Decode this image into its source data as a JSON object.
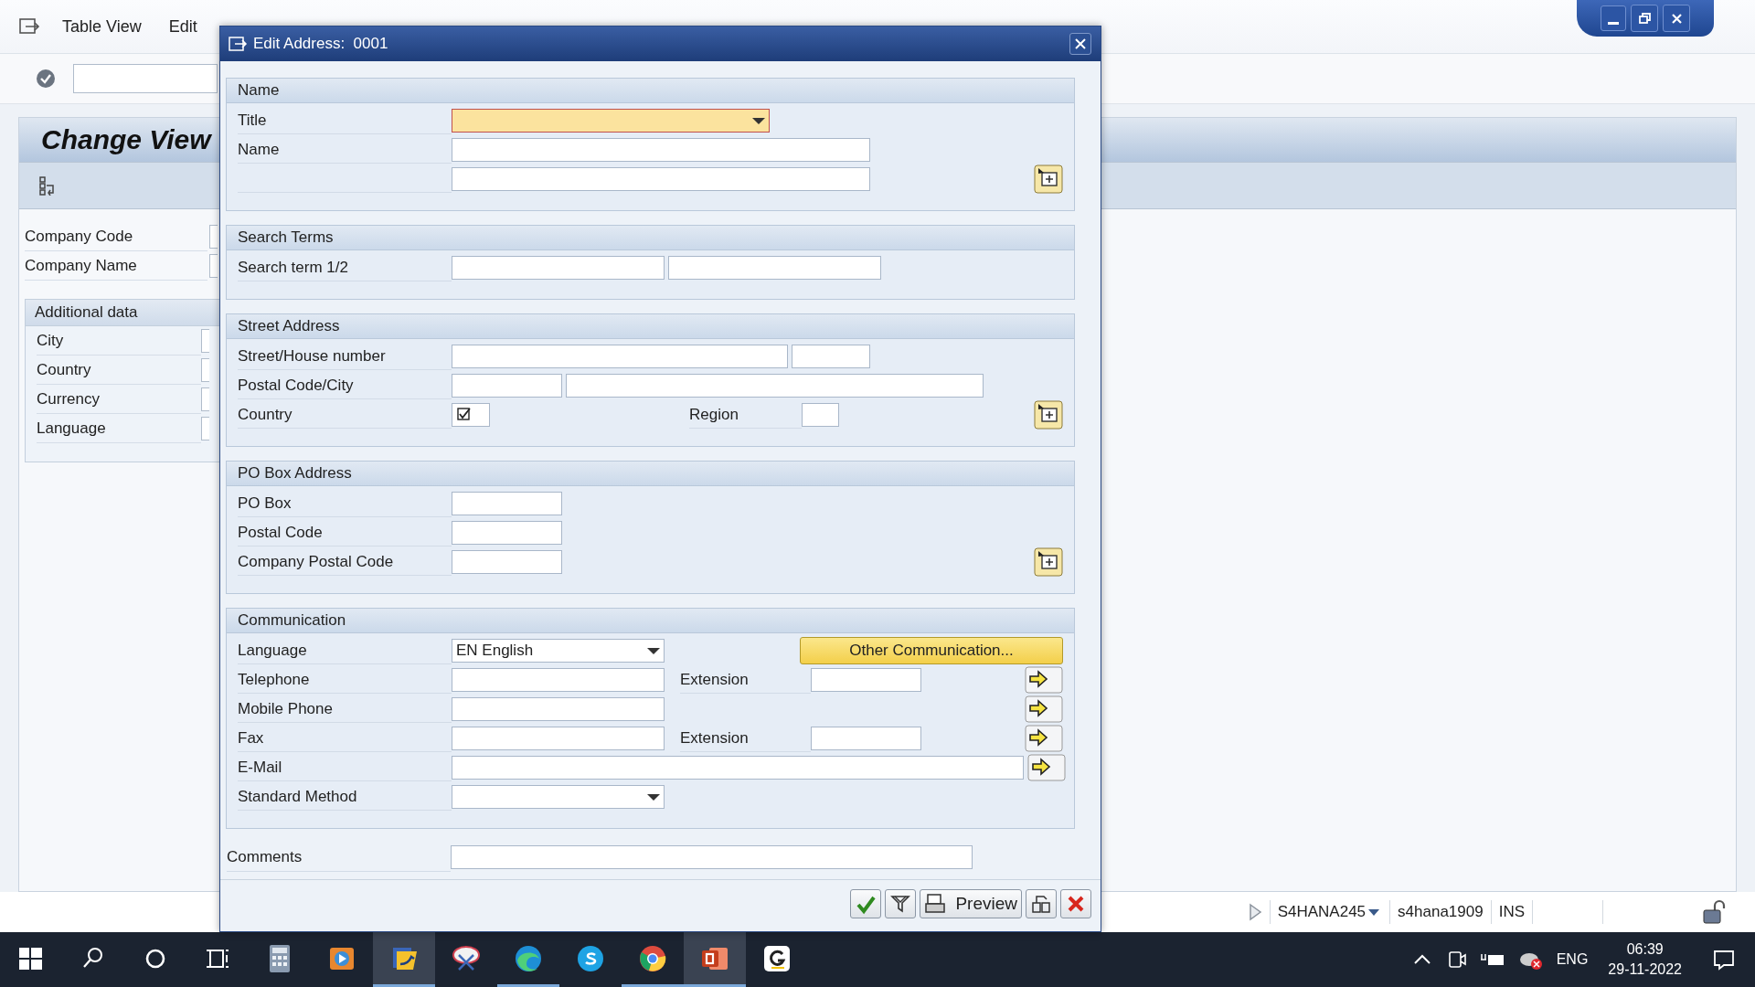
{
  "menu_bar": {
    "items": [
      {
        "label": "Table View"
      },
      {
        "label": "Edit"
      }
    ]
  },
  "screen": {
    "title": "Change View",
    "header_fields": [
      {
        "label": "Company Code"
      },
      {
        "label": "Company Name"
      }
    ],
    "additional_data": {
      "title": "Additional data",
      "fields": [
        {
          "label": "City"
        },
        {
          "label": "Country"
        },
        {
          "label": "Currency"
        },
        {
          "label": "Language"
        }
      ]
    }
  },
  "dialog": {
    "title": "Edit Address:  0001",
    "groups": [
      {
        "title": "Name",
        "rows": [
          {
            "label": "Title",
            "controls": [
              {
                "kind": "dropdown",
                "focused": true
              }
            ]
          },
          {
            "label": "Name",
            "controls": [
              {
                "kind": "field"
              }
            ]
          },
          {
            "controls": [
              {
                "kind": "field"
              },
              {
                "kind": "more"
              }
            ]
          }
        ]
      },
      {
        "title": "Search Terms",
        "rows": [
          {
            "label": "Search term 1/2",
            "controls": [
              {
                "kind": "field"
              },
              {
                "kind": "field"
              }
            ]
          }
        ]
      },
      {
        "title": "Street Address",
        "rows": [
          {
            "label": "Street/House number",
            "controls": [
              {
                "kind": "field"
              },
              {
                "kind": "field"
              }
            ]
          },
          {
            "label": "Postal Code/City",
            "controls": [
              {
                "kind": "field"
              },
              {
                "kind": "field"
              }
            ]
          },
          {
            "label": "Country",
            "controls": [
              {
                "kind": "checkbox",
                "checked": true
              },
              {
                "kind": "label",
                "text": "Region"
              },
              {
                "kind": "field"
              },
              {
                "kind": "more"
              }
            ]
          }
        ]
      },
      {
        "title": "PO Box Address",
        "rows": [
          {
            "label": "PO Box",
            "controls": [
              {
                "kind": "field"
              }
            ]
          },
          {
            "label": "Postal Code",
            "controls": [
              {
                "kind": "field"
              }
            ]
          },
          {
            "label": "Company Postal Code",
            "controls": [
              {
                "kind": "field"
              },
              {
                "kind": "more"
              }
            ]
          }
        ]
      },
      {
        "title": "Communication",
        "rows": [
          {
            "label": "Language",
            "controls": [
              {
                "kind": "dropdown",
                "value": "EN English",
                "focused": false
              },
              {
                "kind": "button",
                "label": "Other Communication..."
              }
            ]
          },
          {
            "label": "Telephone",
            "controls": [
              {
                "kind": "field"
              },
              {
                "kind": "label",
                "text": "Extension"
              },
              {
                "kind": "field"
              },
              {
                "kind": "arrow"
              }
            ]
          },
          {
            "label": "Mobile Phone",
            "controls": [
              {
                "kind": "field"
              },
              {
                "kind": "arrow"
              }
            ]
          },
          {
            "label": "Fax",
            "controls": [
              {
                "kind": "field"
              },
              {
                "kind": "label",
                "text": "Extension"
              },
              {
                "kind": "field"
              },
              {
                "kind": "arrow"
              }
            ]
          },
          {
            "label": "E-Mail",
            "controls": [
              {
                "kind": "field"
              },
              {
                "kind": "arrow"
              }
            ]
          },
          {
            "label": "Standard Method",
            "controls": [
              {
                "kind": "dropdown",
                "focused": false
              }
            ]
          }
        ]
      }
    ],
    "comments": {
      "label": "Comments"
    },
    "buttons": [
      {
        "kind": "confirm"
      },
      {
        "kind": "filter"
      },
      {
        "kind": "preview",
        "label": "Preview"
      },
      {
        "kind": "copy"
      },
      {
        "kind": "cancel"
      }
    ]
  },
  "status_bar": {
    "system": "S4HANA245",
    "client": "s4hana1909",
    "mode": "INS"
  },
  "taskbar": {
    "apps": [
      {
        "kind": "calculator",
        "selected": false,
        "running": false
      },
      {
        "kind": "media",
        "selected": false,
        "running": false
      },
      {
        "kind": "sap",
        "selected": true,
        "running": true
      },
      {
        "kind": "snipping",
        "selected": false,
        "running": false
      },
      {
        "kind": "edge",
        "selected": false,
        "running": true
      },
      {
        "kind": "skype",
        "selected": false,
        "running": false
      },
      {
        "kind": "chrome",
        "selected": false,
        "running": true
      },
      {
        "kind": "powerpoint",
        "selected": true,
        "running": true
      },
      {
        "kind": "grammar",
        "selected": false,
        "running": false
      }
    ],
    "tray": {
      "language": "ENG",
      "time": "06:39",
      "date": "29-11-2022"
    }
  }
}
